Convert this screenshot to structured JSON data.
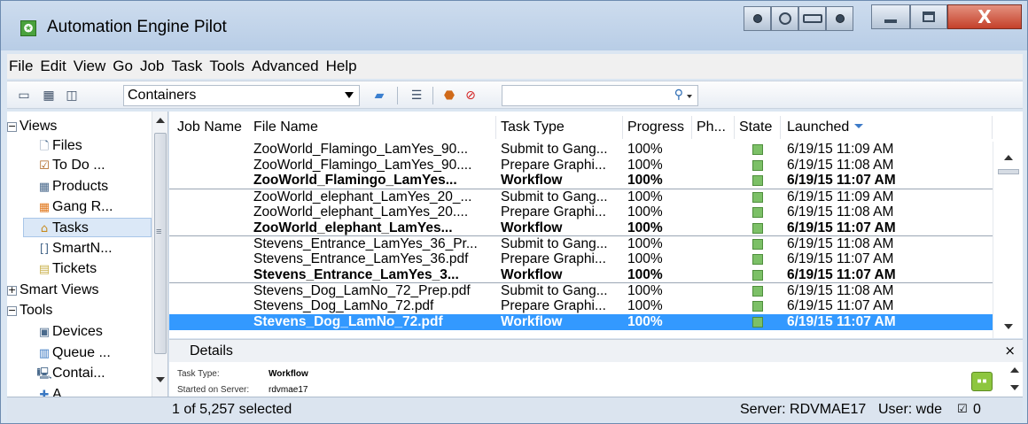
{
  "window": {
    "title": "Automation Engine Pilot",
    "app_icon": "automation-engine-icon",
    "title_tools": [
      "view-toggle-1-icon",
      "view-toggle-2-icon",
      "view-toggle-3-icon",
      "view-toggle-4-icon"
    ],
    "controls": [
      "minimize",
      "maximize",
      "close"
    ]
  },
  "menu": [
    "File",
    "Edit",
    "View",
    "Go",
    "Job",
    "Task",
    "Tools",
    "Advanced",
    "Help"
  ],
  "toolbar": {
    "view_icons": [
      "single-pane-icon",
      "grid-view-icon",
      "panel-view-icon"
    ],
    "container_select": "Containers",
    "action_icons": [
      "new-folder-icon",
      "tasks-list-icon",
      "launch-icon",
      "stop-icon"
    ],
    "search_value": "",
    "search_icon": "search-icon"
  },
  "tree": [
    {
      "label": "Views",
      "type": "group",
      "expanded": true
    },
    {
      "label": "Files",
      "icon": "file-icon"
    },
    {
      "label": "To Do ...",
      "icon": "todo-icon"
    },
    {
      "label": "Products",
      "icon": "products-icon"
    },
    {
      "label": "Gang R...",
      "icon": "gang-run-icon"
    },
    {
      "label": "Tasks",
      "icon": "tasks-icon",
      "selected": true
    },
    {
      "label": "SmartN...",
      "icon": "smartnames-icon"
    },
    {
      "label": "Tickets",
      "icon": "tickets-icon"
    },
    {
      "label": "Smart Views",
      "type": "group",
      "expanded": false
    },
    {
      "label": "Tools",
      "type": "group",
      "expanded": true
    },
    {
      "label": "Devices",
      "icon": "devices-icon"
    },
    {
      "label": "Queue ...",
      "icon": "queue-icon"
    },
    {
      "label": "Contai...",
      "icon": "containers-icon"
    },
    {
      "label": "A......",
      "icon": "access-icon"
    }
  ],
  "grid": {
    "columns": [
      "Job Name",
      "File Name",
      "Task Type",
      "Progress",
      "Ph...",
      "State",
      "Launched"
    ],
    "sorted_column": "Launched",
    "rows": [
      {
        "file": "ZooWorld_Flamingo_LamYes_90...",
        "type": "Submit to Gang...",
        "progress": "100%",
        "launched": "6/19/15 11:09 AM",
        "bold": false,
        "group_start": true
      },
      {
        "file": "ZooWorld_Flamingo_LamYes_90....",
        "type": "Prepare Graphi...",
        "progress": "100%",
        "launched": "6/19/15 11:08 AM",
        "bold": false
      },
      {
        "file": "ZooWorld_Flamingo_LamYes...",
        "type": "Workflow",
        "progress": "100%",
        "launched": "6/19/15 11:07 AM",
        "bold": true
      },
      {
        "file": "ZooWorld_elephant_LamYes_20_...",
        "type": "Submit to Gang...",
        "progress": "100%",
        "launched": "6/19/15 11:09 AM",
        "bold": false,
        "group_start": true
      },
      {
        "file": "ZooWorld_elephant_LamYes_20....",
        "type": "Prepare Graphi...",
        "progress": "100%",
        "launched": "6/19/15 11:08 AM",
        "bold": false
      },
      {
        "file": "ZooWorld_elephant_LamYes...",
        "type": "Workflow",
        "progress": "100%",
        "launched": "6/19/15 11:07 AM",
        "bold": true
      },
      {
        "file": "Stevens_Entrance_LamYes_36_Pr...",
        "type": "Submit to Gang...",
        "progress": "100%",
        "launched": "6/19/15 11:08 AM",
        "bold": false,
        "group_start": true
      },
      {
        "file": "Stevens_Entrance_LamYes_36.pdf",
        "type": "Prepare Graphi...",
        "progress": "100%",
        "launched": "6/19/15 11:07 AM",
        "bold": false
      },
      {
        "file": "Stevens_Entrance_LamYes_3...",
        "type": "Workflow",
        "progress": "100%",
        "launched": "6/19/15 11:07 AM",
        "bold": true
      },
      {
        "file": "Stevens_Dog_LamNo_72_Prep.pdf",
        "type": "Submit to Gang...",
        "progress": "100%",
        "launched": "6/19/15 11:08 AM",
        "bold": false,
        "group_start": true
      },
      {
        "file": "Stevens_Dog_LamNo_72.pdf",
        "type": "Prepare Graphi...",
        "progress": "100%",
        "launched": "6/19/15 11:07 AM",
        "bold": false
      },
      {
        "file": "Stevens_Dog_LamNo_72.pdf",
        "type": "Workflow",
        "progress": "100%",
        "launched": "6/19/15 11:07 AM",
        "bold": true,
        "selected": true
      }
    ]
  },
  "details": {
    "title": "Details",
    "close_label": "×",
    "fields": [
      {
        "key": "Task Type:",
        "value": "Workflow"
      },
      {
        "key": "Started on Server:",
        "value": "rdvmae17"
      }
    ],
    "icon": "workflow-icon"
  },
  "status": {
    "selection": "1 of 5,257 selected",
    "server": "Server: RDVMAE17",
    "user": "User: wde",
    "todo_count": "0"
  },
  "colors": {
    "selection": "#3399ff",
    "state_ok": "#7cc067",
    "close_button": "#c4402a",
    "titlebar": "#c4d6ec"
  }
}
